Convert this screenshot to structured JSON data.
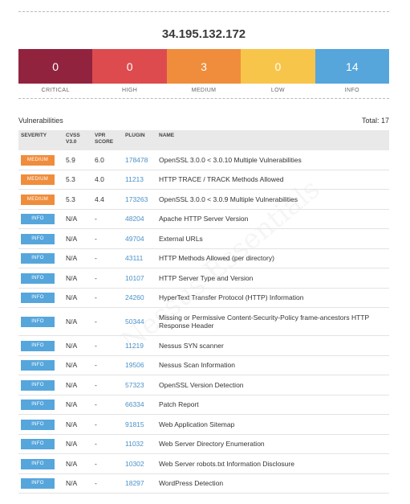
{
  "host": "34.195.132.172",
  "watermark": "Nessus Essentials",
  "severity_counts": [
    {
      "label": "CRITICAL",
      "count": "0",
      "color": "#92233f"
    },
    {
      "label": "HIGH",
      "count": "0",
      "color": "#dd4b4f"
    },
    {
      "label": "MEDIUM",
      "count": "3",
      "color": "#ef8d3c"
    },
    {
      "label": "LOW",
      "count": "0",
      "color": "#f7c54a"
    },
    {
      "label": "INFO",
      "count": "14",
      "color": "#56a6dc"
    }
  ],
  "section_title": "Vulnerabilities",
  "total_label": "Total: 17",
  "columns": [
    "SEVERITY",
    "CVSS V3.0",
    "VPR SCORE",
    "PLUGIN",
    "NAME"
  ],
  "rows": [
    {
      "severity": "MEDIUM",
      "cvss": "5.9",
      "vpr": "6.0",
      "plugin": "178478",
      "name": "OpenSSL 3.0.0 < 3.0.10 Multiple Vulnerabilities"
    },
    {
      "severity": "MEDIUM",
      "cvss": "5.3",
      "vpr": "4.0",
      "plugin": "11213",
      "name": "HTTP TRACE / TRACK Methods Allowed"
    },
    {
      "severity": "MEDIUM",
      "cvss": "5.3",
      "vpr": "4.4",
      "plugin": "173263",
      "name": "OpenSSL 3.0.0 < 3.0.9 Multiple Vulnerabilities"
    },
    {
      "severity": "INFO",
      "cvss": "N/A",
      "vpr": "-",
      "plugin": "48204",
      "name": "Apache HTTP Server Version"
    },
    {
      "severity": "INFO",
      "cvss": "N/A",
      "vpr": "-",
      "plugin": "49704",
      "name": "External URLs"
    },
    {
      "severity": "INFO",
      "cvss": "N/A",
      "vpr": "-",
      "plugin": "43111",
      "name": "HTTP Methods Allowed (per directory)"
    },
    {
      "severity": "INFO",
      "cvss": "N/A",
      "vpr": "-",
      "plugin": "10107",
      "name": "HTTP Server Type and Version"
    },
    {
      "severity": "INFO",
      "cvss": "N/A",
      "vpr": "-",
      "plugin": "24260",
      "name": "HyperText Transfer Protocol (HTTP) Information"
    },
    {
      "severity": "INFO",
      "cvss": "N/A",
      "vpr": "-",
      "plugin": "50344",
      "name": "Missing or Permissive Content-Security-Policy frame-ancestors HTTP Response Header"
    },
    {
      "severity": "INFO",
      "cvss": "N/A",
      "vpr": "-",
      "plugin": "11219",
      "name": "Nessus SYN scanner"
    },
    {
      "severity": "INFO",
      "cvss": "N/A",
      "vpr": "-",
      "plugin": "19506",
      "name": "Nessus Scan Information"
    },
    {
      "severity": "INFO",
      "cvss": "N/A",
      "vpr": "-",
      "plugin": "57323",
      "name": "OpenSSL Version Detection"
    },
    {
      "severity": "INFO",
      "cvss": "N/A",
      "vpr": "-",
      "plugin": "66334",
      "name": "Patch Report"
    },
    {
      "severity": "INFO",
      "cvss": "N/A",
      "vpr": "-",
      "plugin": "91815",
      "name": "Web Application Sitemap"
    },
    {
      "severity": "INFO",
      "cvss": "N/A",
      "vpr": "-",
      "plugin": "11032",
      "name": "Web Server Directory Enumeration"
    },
    {
      "severity": "INFO",
      "cvss": "N/A",
      "vpr": "-",
      "plugin": "10302",
      "name": "Web Server robots.txt Information Disclosure"
    },
    {
      "severity": "INFO",
      "cvss": "N/A",
      "vpr": "-",
      "plugin": "18297",
      "name": "WordPress Detection"
    }
  ],
  "badge_colors": {
    "MEDIUM": "#ef8d3c",
    "INFO": "#56a6dc"
  }
}
